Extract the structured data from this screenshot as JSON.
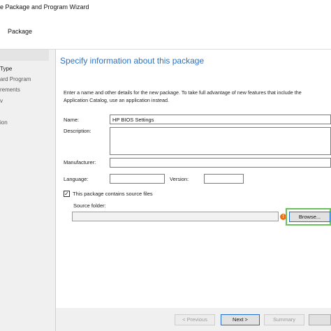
{
  "window": {
    "title": "e Package and Program Wizard"
  },
  "header": {
    "title": "Package"
  },
  "nav": {
    "items": [
      {
        "label": " Type"
      },
      {
        "label": "ard Program"
      },
      {
        "label": "rements"
      },
      {
        "label": "v"
      },
      {
        "label": "ion"
      }
    ]
  },
  "main": {
    "heading": "Specify information about this package",
    "description": "Enter a name and other details for the new package. To take full advantage of new features that include the Application Catalog, use an application instead.",
    "name_label": "Name:",
    "name_value": "HP BIOS Settings",
    "description_label": "Description:",
    "description_value": "",
    "manufacturer_label": "Manufacturer:",
    "manufacturer_value": "",
    "language_label": "Language:",
    "language_value": "",
    "version_label": "Version:",
    "version_value": "",
    "source_checkbox_label": "This package contains source files",
    "source_checkbox_mark": "✓",
    "source_folder_label": "Source folder:",
    "source_folder_value": "",
    "warning_glyph": "!",
    "browse_label": "Browse..."
  },
  "footer": {
    "previous_label": "< Previous",
    "next_label": "Next >",
    "summary_label": "Summary"
  },
  "colors": {
    "heading": "#2a73c5",
    "highlight": "#6bc15a",
    "warning": "#e8711c"
  }
}
